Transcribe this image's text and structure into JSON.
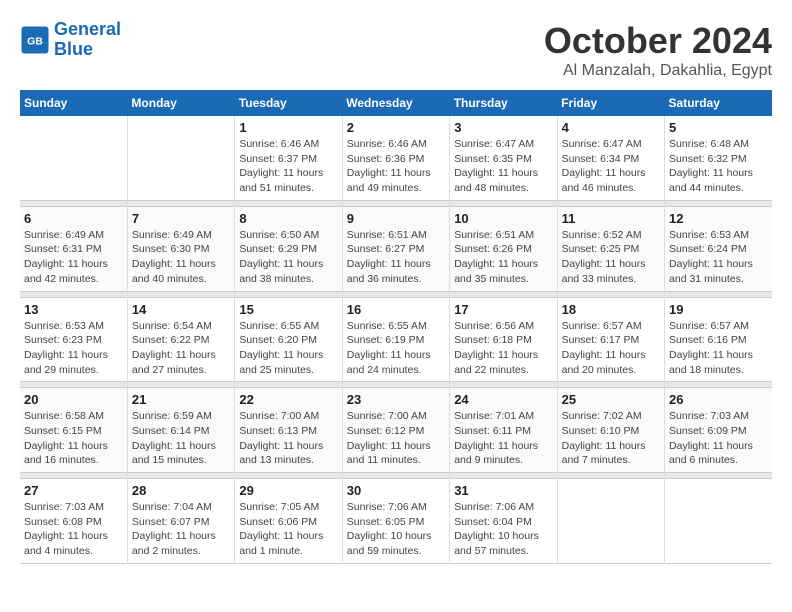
{
  "header": {
    "logo_line1": "General",
    "logo_line2": "Blue",
    "month": "October 2024",
    "location": "Al Manzalah, Dakahlia, Egypt"
  },
  "days_of_week": [
    "Sunday",
    "Monday",
    "Tuesday",
    "Wednesday",
    "Thursday",
    "Friday",
    "Saturday"
  ],
  "weeks": [
    [
      {
        "day": "",
        "info": ""
      },
      {
        "day": "",
        "info": ""
      },
      {
        "day": "1",
        "info": "Sunrise: 6:46 AM\nSunset: 6:37 PM\nDaylight: 11 hours\nand 51 minutes."
      },
      {
        "day": "2",
        "info": "Sunrise: 6:46 AM\nSunset: 6:36 PM\nDaylight: 11 hours\nand 49 minutes."
      },
      {
        "day": "3",
        "info": "Sunrise: 6:47 AM\nSunset: 6:35 PM\nDaylight: 11 hours\nand 48 minutes."
      },
      {
        "day": "4",
        "info": "Sunrise: 6:47 AM\nSunset: 6:34 PM\nDaylight: 11 hours\nand 46 minutes."
      },
      {
        "day": "5",
        "info": "Sunrise: 6:48 AM\nSunset: 6:32 PM\nDaylight: 11 hours\nand 44 minutes."
      }
    ],
    [
      {
        "day": "6",
        "info": "Sunrise: 6:49 AM\nSunset: 6:31 PM\nDaylight: 11 hours\nand 42 minutes."
      },
      {
        "day": "7",
        "info": "Sunrise: 6:49 AM\nSunset: 6:30 PM\nDaylight: 11 hours\nand 40 minutes."
      },
      {
        "day": "8",
        "info": "Sunrise: 6:50 AM\nSunset: 6:29 PM\nDaylight: 11 hours\nand 38 minutes."
      },
      {
        "day": "9",
        "info": "Sunrise: 6:51 AM\nSunset: 6:27 PM\nDaylight: 11 hours\nand 36 minutes."
      },
      {
        "day": "10",
        "info": "Sunrise: 6:51 AM\nSunset: 6:26 PM\nDaylight: 11 hours\nand 35 minutes."
      },
      {
        "day": "11",
        "info": "Sunrise: 6:52 AM\nSunset: 6:25 PM\nDaylight: 11 hours\nand 33 minutes."
      },
      {
        "day": "12",
        "info": "Sunrise: 6:53 AM\nSunset: 6:24 PM\nDaylight: 11 hours\nand 31 minutes."
      }
    ],
    [
      {
        "day": "13",
        "info": "Sunrise: 6:53 AM\nSunset: 6:23 PM\nDaylight: 11 hours\nand 29 minutes."
      },
      {
        "day": "14",
        "info": "Sunrise: 6:54 AM\nSunset: 6:22 PM\nDaylight: 11 hours\nand 27 minutes."
      },
      {
        "day": "15",
        "info": "Sunrise: 6:55 AM\nSunset: 6:20 PM\nDaylight: 11 hours\nand 25 minutes."
      },
      {
        "day": "16",
        "info": "Sunrise: 6:55 AM\nSunset: 6:19 PM\nDaylight: 11 hours\nand 24 minutes."
      },
      {
        "day": "17",
        "info": "Sunrise: 6:56 AM\nSunset: 6:18 PM\nDaylight: 11 hours\nand 22 minutes."
      },
      {
        "day": "18",
        "info": "Sunrise: 6:57 AM\nSunset: 6:17 PM\nDaylight: 11 hours\nand 20 minutes."
      },
      {
        "day": "19",
        "info": "Sunrise: 6:57 AM\nSunset: 6:16 PM\nDaylight: 11 hours\nand 18 minutes."
      }
    ],
    [
      {
        "day": "20",
        "info": "Sunrise: 6:58 AM\nSunset: 6:15 PM\nDaylight: 11 hours\nand 16 minutes."
      },
      {
        "day": "21",
        "info": "Sunrise: 6:59 AM\nSunset: 6:14 PM\nDaylight: 11 hours\nand 15 minutes."
      },
      {
        "day": "22",
        "info": "Sunrise: 7:00 AM\nSunset: 6:13 PM\nDaylight: 11 hours\nand 13 minutes."
      },
      {
        "day": "23",
        "info": "Sunrise: 7:00 AM\nSunset: 6:12 PM\nDaylight: 11 hours\nand 11 minutes."
      },
      {
        "day": "24",
        "info": "Sunrise: 7:01 AM\nSunset: 6:11 PM\nDaylight: 11 hours\nand 9 minutes."
      },
      {
        "day": "25",
        "info": "Sunrise: 7:02 AM\nSunset: 6:10 PM\nDaylight: 11 hours\nand 7 minutes."
      },
      {
        "day": "26",
        "info": "Sunrise: 7:03 AM\nSunset: 6:09 PM\nDaylight: 11 hours\nand 6 minutes."
      }
    ],
    [
      {
        "day": "27",
        "info": "Sunrise: 7:03 AM\nSunset: 6:08 PM\nDaylight: 11 hours\nand 4 minutes."
      },
      {
        "day": "28",
        "info": "Sunrise: 7:04 AM\nSunset: 6:07 PM\nDaylight: 11 hours\nand 2 minutes."
      },
      {
        "day": "29",
        "info": "Sunrise: 7:05 AM\nSunset: 6:06 PM\nDaylight: 11 hours\nand 1 minute."
      },
      {
        "day": "30",
        "info": "Sunrise: 7:06 AM\nSunset: 6:05 PM\nDaylight: 10 hours\nand 59 minutes."
      },
      {
        "day": "31",
        "info": "Sunrise: 7:06 AM\nSunset: 6:04 PM\nDaylight: 10 hours\nand 57 minutes."
      },
      {
        "day": "",
        "info": ""
      },
      {
        "day": "",
        "info": ""
      }
    ]
  ]
}
